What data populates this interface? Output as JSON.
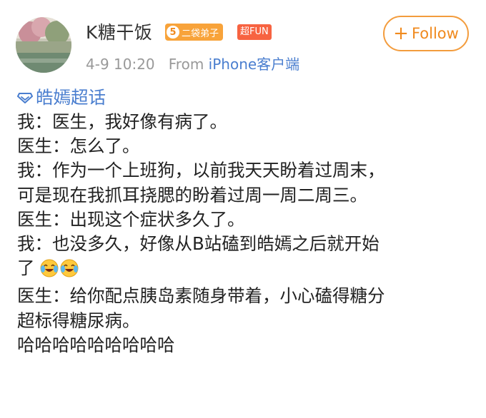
{
  "user": {
    "name": "K糖干饭",
    "level": "5",
    "level_title": "二袋弟子",
    "fun_badge": "超FUN"
  },
  "post": {
    "date": "4-9 10:20",
    "source_prefix": "From",
    "source": "iPhone客户端",
    "topic": "皓嫣超话",
    "lines": [
      "我：医生，我好像有病了。",
      "医生：怎么了。",
      "我：作为一个上班狗，以前我天天盼着过周末，",
      "可是现在我抓耳挠腮的盼着过周一周二周三。",
      "医生：出现这个症状多久了。",
      "我：也没多久，好像从B站磕到皓嫣之后就开始",
      "了",
      "医生：给你配点胰岛素随身带着，小心磕得糖分",
      "超标得糖尿病。",
      "哈哈哈哈哈哈哈哈哈"
    ],
    "emoji": [
      "laugh-cry-emoji",
      "laugh-cry-emoji"
    ]
  },
  "follow": {
    "label": "Follow"
  },
  "colors": {
    "accent": "#f08a1e",
    "link": "#4a7ecf",
    "meta": "#999999",
    "fun_badge": "#f76341"
  }
}
